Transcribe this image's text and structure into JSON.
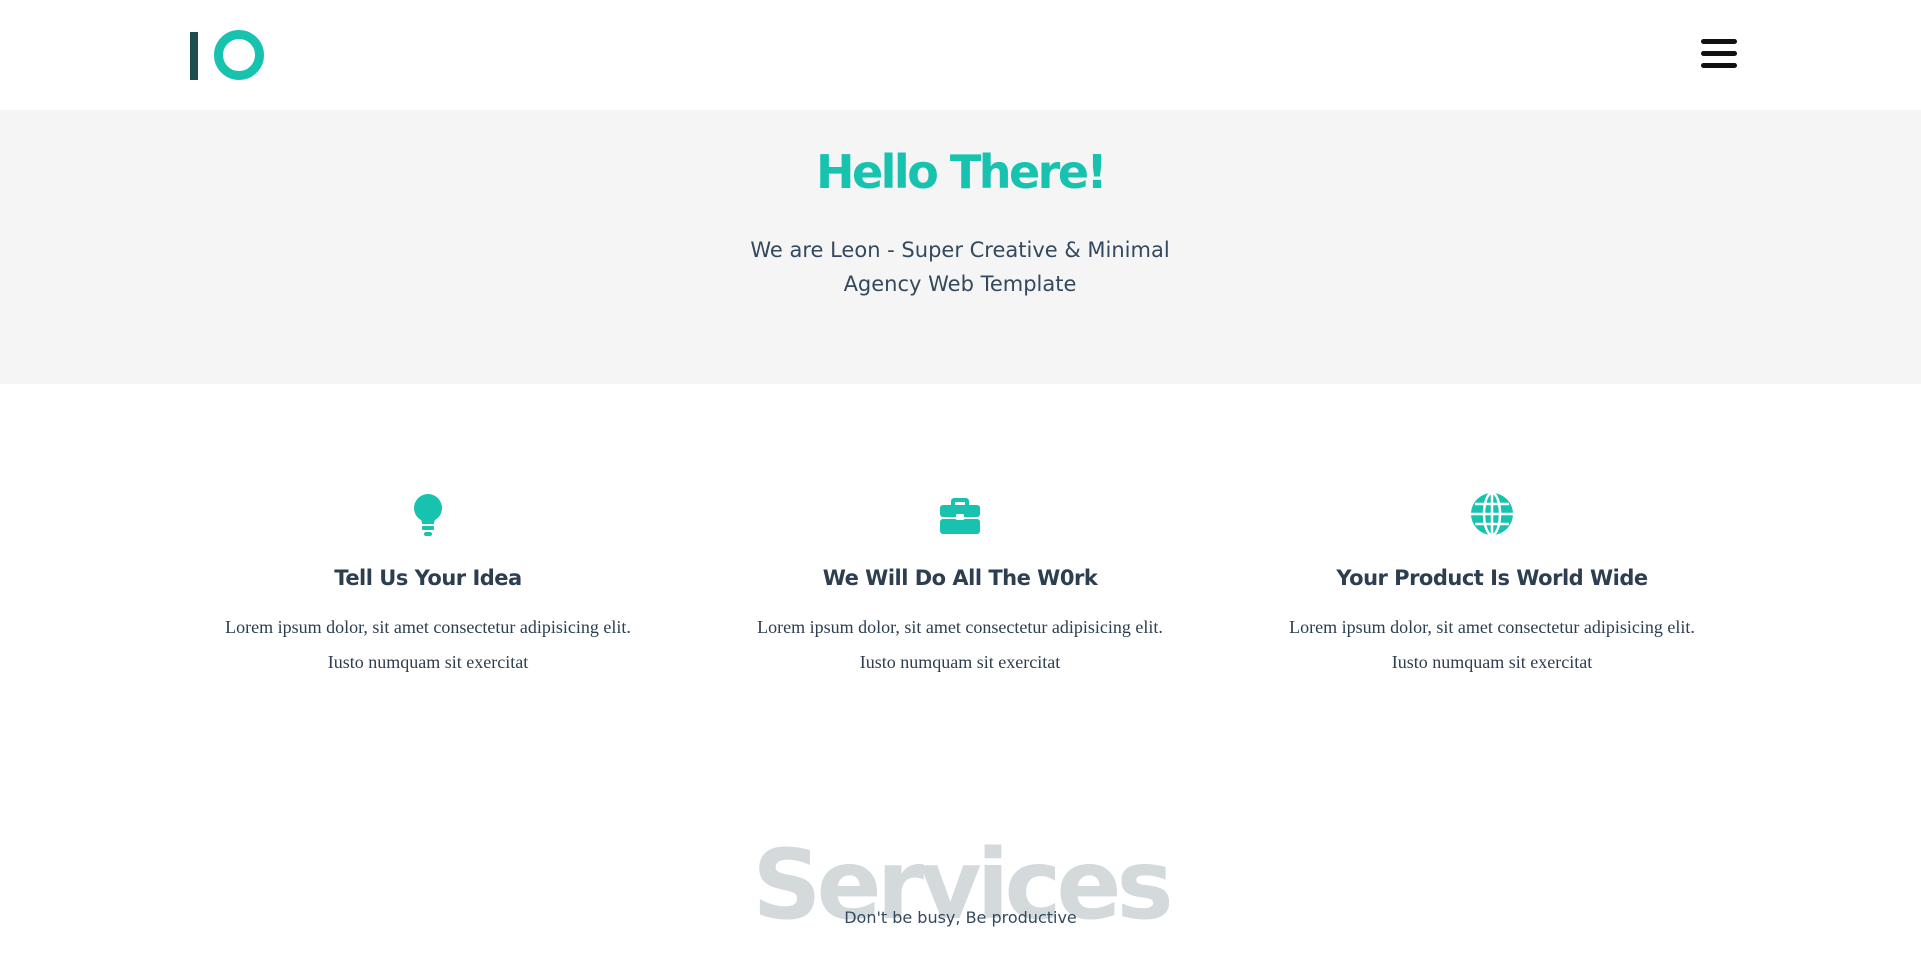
{
  "colors": {
    "accent": "#17c2af",
    "logo_dark": "#1f4c4c",
    "hero_bg": "#f5f5f5",
    "text": "#2c3e50",
    "services_ghost": "#d4d9dc"
  },
  "header": {
    "logo_icon": "io-logo",
    "menu_icon": "hamburger-menu-icon"
  },
  "hero": {
    "title": "Hello There!",
    "subtitle": "We are Leon - Super Creative & Minimal Agency Web Template"
  },
  "features": [
    {
      "icon": "lightbulb-icon",
      "title": "Tell Us Your Idea",
      "text_line1": "Lorem ipsum dolor, sit amet consectetur adipisicing elit.",
      "text_line2": "Iusto numquam sit exercitat"
    },
    {
      "icon": "briefcase-icon",
      "title": "We Will Do All The W0rk",
      "text_line1": "Lorem ipsum dolor, sit amet consectetur adipisicing elit.",
      "text_line2": "Iusto numquam sit exercitat"
    },
    {
      "icon": "globe-icon",
      "title": "Your Product Is World Wide",
      "text_line1": "Lorem ipsum dolor, sit amet consectetur adipisicing elit.",
      "text_line2": "Iusto numquam sit exercitat"
    }
  ],
  "services": {
    "heading": "Services",
    "subtitle": "Don't be busy, Be productive"
  }
}
